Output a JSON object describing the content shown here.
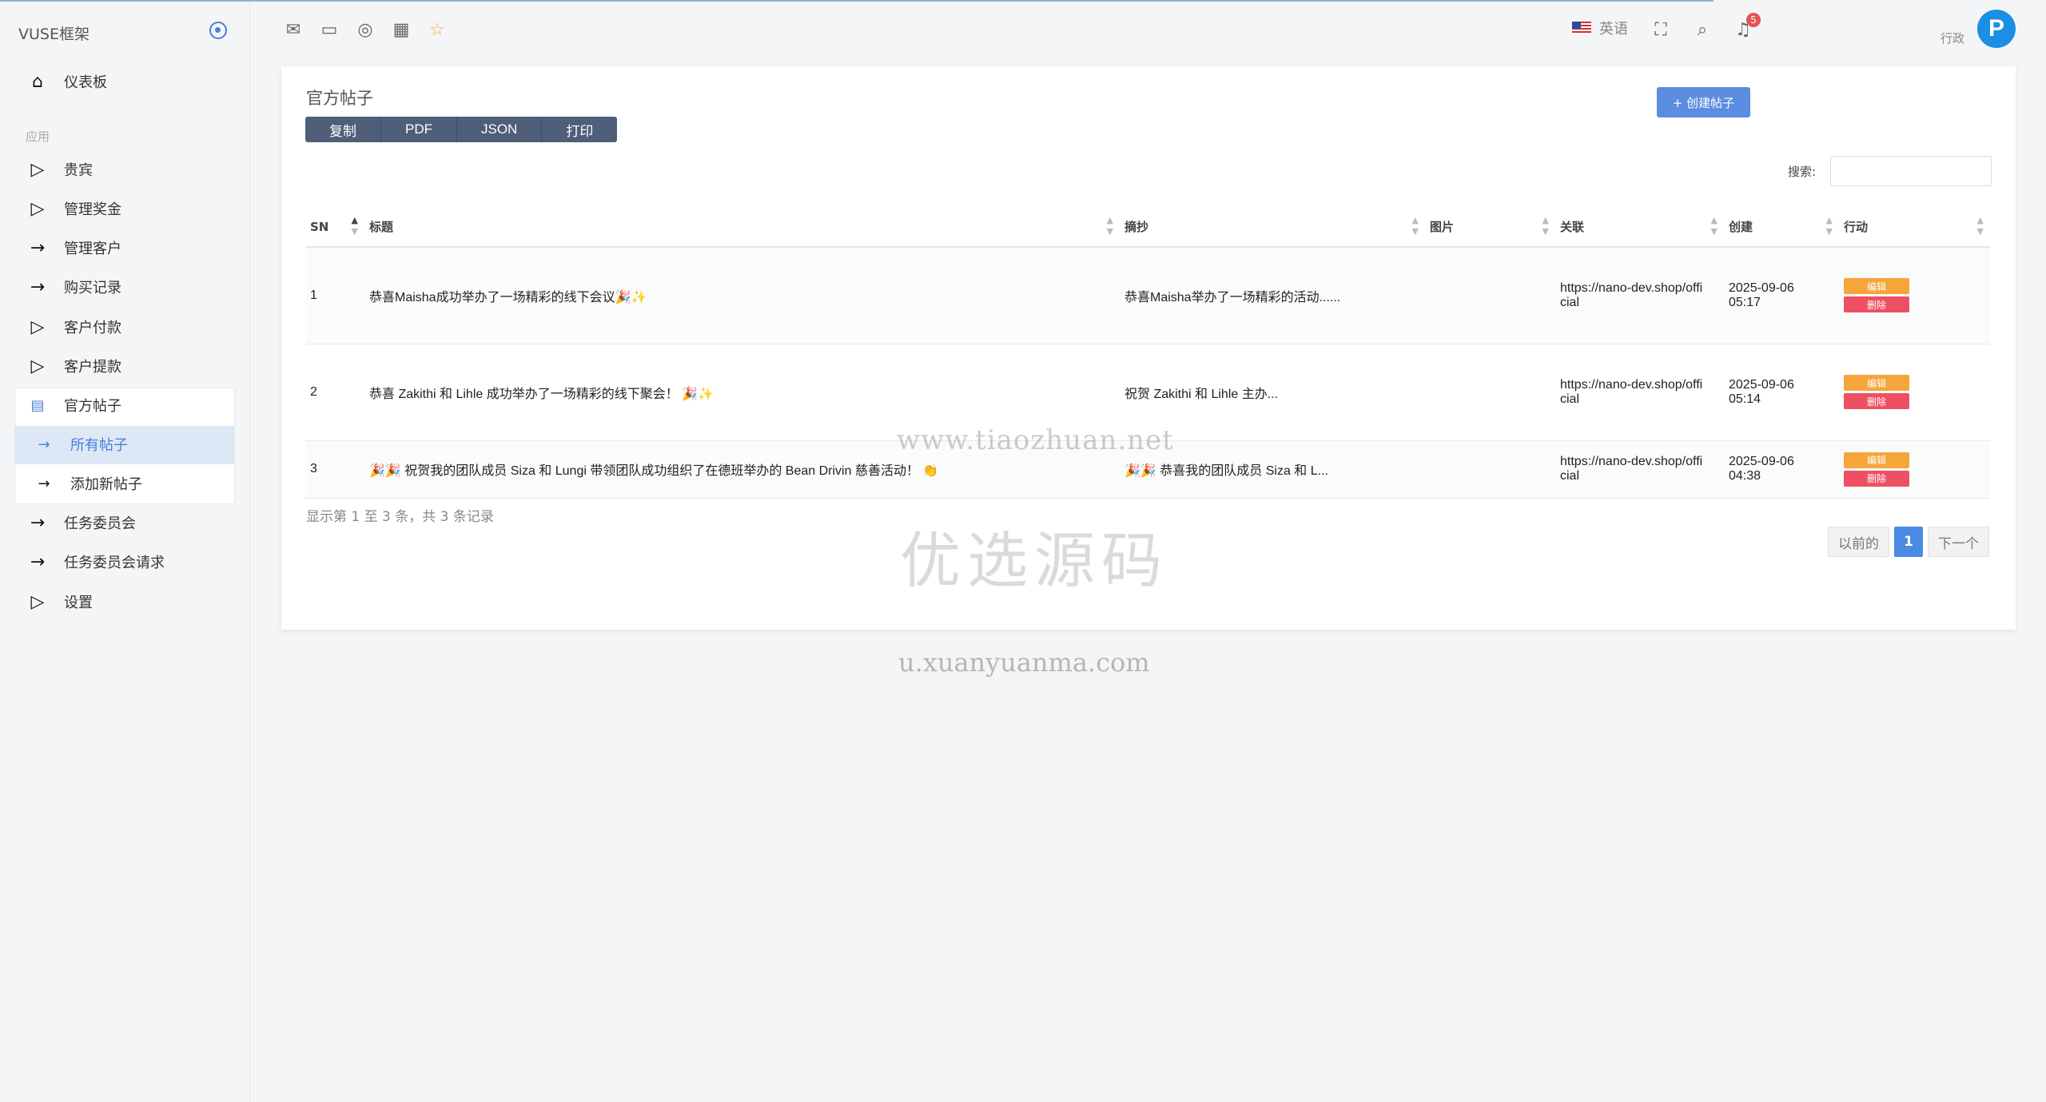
{
  "brand": "VUSE框架",
  "sidebar": {
    "dashboard": "仪表板",
    "section_label": "应用",
    "items": [
      "贵宾",
      "管理奖金",
      "管理客户",
      "购买记录",
      "客户付款",
      "客户提款",
      "官方帖子"
    ],
    "submenu": [
      "所有帖子",
      "添加新帖子"
    ],
    "bottom_items": [
      "任务委员会",
      "任务委员会请求",
      "设置"
    ]
  },
  "header": {
    "language": "英语",
    "notification_count": "5",
    "user_role": "行政",
    "avatar_letter": "P"
  },
  "card": {
    "title": "官方帖子",
    "export_buttons": [
      "复制",
      "PDF",
      "JSON",
      "打印"
    ],
    "create_button": "+ 创建帖子",
    "search_label": "搜索:"
  },
  "table": {
    "columns": [
      "SN",
      "标题",
      "摘抄",
      "图片",
      "关联",
      "创建",
      "行动"
    ],
    "rows": [
      {
        "sn": "1",
        "title": "恭喜Maisha成功举办了一场精彩的线下会议🎉✨",
        "excerpt": "恭喜Maisha举办了一场精彩的活动......",
        "image": "",
        "link": "https://nano-dev.shop/official",
        "created": "2025-09-06 05:17"
      },
      {
        "sn": "2",
        "title": "恭喜 Zakithi 和 Lihle 成功举办了一场精彩的线下聚会！ 🎉✨",
        "excerpt": "祝贺 Zakithi 和 Lihle 主办...",
        "image": "",
        "link": "https://nano-dev.shop/official",
        "created": "2025-09-06 05:14"
      },
      {
        "sn": "3",
        "title": "🎉🎉 祝贺我的团队成员 Siza 和 Lungi 带领团队成功组织了在德班举办的 Bean Drivin 慈善活动！ 👏",
        "excerpt": "🎉🎉 恭喜我的团队成员 Siza 和 L...",
        "image": "",
        "link": "https://nano-dev.shop/official",
        "created": "2025-09-06 04:38"
      }
    ],
    "edit_label": "编辑",
    "delete_label": "删除"
  },
  "footer": {
    "info": "显示第 1 至 3 条，共 3 条记录",
    "prev": "以前的",
    "current_page": "1",
    "next": "下一个"
  },
  "watermarks": [
    "www.tiaozhuan.net",
    "优选源码",
    "u.xuanyuanma.com"
  ]
}
